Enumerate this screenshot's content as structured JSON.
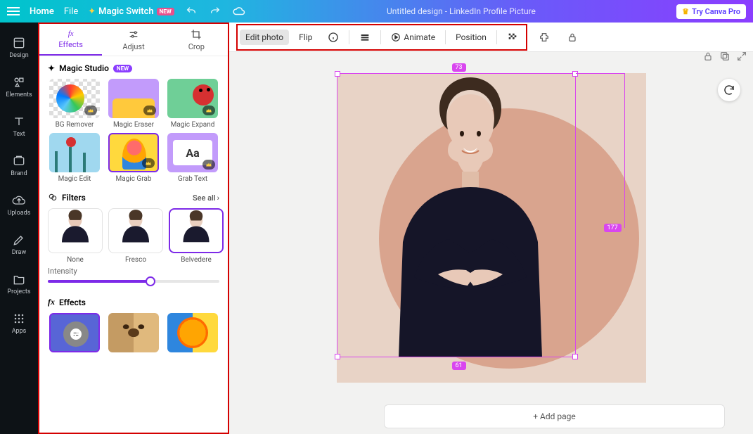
{
  "topbar": {
    "home": "Home",
    "file": "File",
    "magic_switch": "Magic Switch",
    "magic_switch_badge": "NEW",
    "title": "Untitled design - LinkedIn Profile Picture",
    "try_pro": "Try Canva Pro"
  },
  "rail": {
    "items": [
      {
        "label": "Design"
      },
      {
        "label": "Elements"
      },
      {
        "label": "Text"
      },
      {
        "label": "Brand"
      },
      {
        "label": "Uploads"
      },
      {
        "label": "Draw"
      },
      {
        "label": "Projects"
      },
      {
        "label": "Apps"
      }
    ]
  },
  "panel": {
    "tabs": {
      "effects": "Effects",
      "adjust": "Adjust",
      "crop": "Crop"
    },
    "magic_studio": {
      "title": "Magic Studio",
      "badge": "NEW",
      "tools": [
        {
          "label": "BG Remover"
        },
        {
          "label": "Magic Eraser"
        },
        {
          "label": "Magic Expand"
        },
        {
          "label": "Magic Edit"
        },
        {
          "label": "Magic Grab"
        },
        {
          "label": "Grab Text"
        }
      ]
    },
    "filters": {
      "title": "Filters",
      "see_all": "See all",
      "items": [
        {
          "label": "None"
        },
        {
          "label": "Fresco"
        },
        {
          "label": "Belvedere"
        }
      ],
      "intensity_label": "Intensity"
    },
    "effects": {
      "title": "Effects"
    }
  },
  "toolbar": {
    "edit_photo": "Edit photo",
    "flip": "Flip",
    "animate": "Animate",
    "position": "Position"
  },
  "canvas": {
    "measure_top": "73",
    "measure_right": "177",
    "measure_bottom": "61",
    "add_page": "+ Add page"
  }
}
